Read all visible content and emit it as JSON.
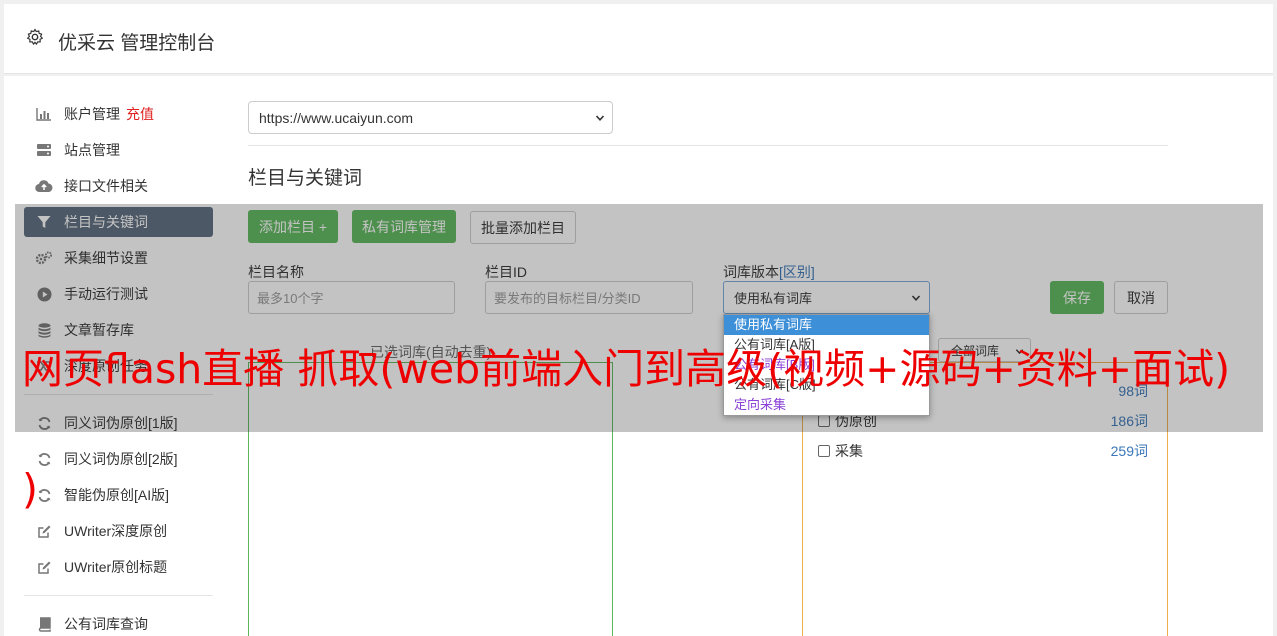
{
  "header": {
    "title": "优采云 管理控制台",
    "icon": "gear-icon"
  },
  "sidebar": {
    "items": [
      {
        "label": "账户管理",
        "badge": "充值",
        "icon": "bar-chart-icon"
      },
      {
        "label": "站点管理",
        "icon": "server-icon"
      },
      {
        "label": "接口文件相关",
        "icon": "cloud-upload-icon"
      },
      {
        "label": "栏目与关键词",
        "icon": "filter-icon",
        "active": true
      },
      {
        "label": "采集细节设置",
        "icon": "cogs-icon"
      },
      {
        "label": "手动运行测试",
        "icon": "play-circle-icon"
      },
      {
        "label": "文章暂存库",
        "icon": "database-icon"
      },
      {
        "label": "深度原创任务",
        "icon": "random-icon"
      },
      {
        "label": "同义词伪原创[1版]",
        "icon": "refresh-icon"
      },
      {
        "label": "同义词伪原创[2版]",
        "icon": "refresh-icon"
      },
      {
        "label": "智能伪原创[AI版]",
        "icon": "refresh-icon"
      },
      {
        "label": "UWriter深度原创",
        "icon": "edit-icon"
      },
      {
        "label": "UWriter原创标题",
        "icon": "edit-icon"
      },
      {
        "label": "公有词库查询",
        "icon": "book-icon"
      }
    ]
  },
  "site": {
    "selected": "https://www.ucaiyun.com"
  },
  "section": {
    "title": "栏目与关键词"
  },
  "toolbar": {
    "add_column": "添加栏目 +",
    "private_lib": "私有词库管理",
    "batch_add": "批量添加栏目"
  },
  "form": {
    "name_label": "栏目名称",
    "name_placeholder": "最多10个字",
    "id_label": "栏目ID",
    "id_placeholder": "要发布的目标栏目/分类ID",
    "version_label": "词库版本",
    "version_link": "[区别]",
    "version_selected": "使用私有词库",
    "save": "保存",
    "cancel": "取消"
  },
  "dropdown": {
    "options": [
      "使用私有词库",
      "公有词库[A版]",
      "公有词库[B版]",
      "公有词库[C版]",
      "定向采集"
    ]
  },
  "lists": {
    "selected_header": "已选词库(自动去重)",
    "filter_selected": "全部词库"
  },
  "libraries": [
    {
      "label": "",
      "count": "98词"
    },
    {
      "label": "伪原创",
      "count": "186词"
    },
    {
      "label": "采集",
      "count": "259词"
    }
  ],
  "watermark": {
    "line1": "网页flash直播 抓取(web前端入门到高级(视频+源码+资料+面试)",
    "line2": ")"
  },
  "colors": {
    "accent_green": "#5cb85c",
    "active_nav": "#5b6b7d",
    "link_blue": "#3a77b8",
    "watermark_red": "#ee0000"
  }
}
